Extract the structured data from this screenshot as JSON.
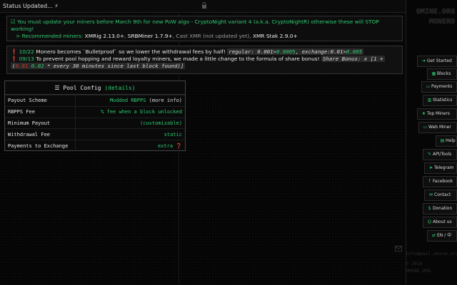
{
  "status": {
    "text": "Status Updated... ⚡"
  },
  "notice": {
    "icon": "check-square-icon",
    "line1": "You must update your miners before March 9th for new PoW algo - CryptoNight variant 4 (a.k.a. CryptoNightR) otherwise these will STOP working!",
    "rec_prefix": "> Recommended miners:",
    "miners": [
      "XMRig 2.13.0+",
      "SRBMiner 1.7.9+",
      "Cast XMR",
      "(not updated yet),",
      "XMR Stak 2.9.0+"
    ]
  },
  "news": [
    {
      "date": "10/22",
      "text": "Monero becomes `Bulletproof` so we lower the withdrawal fees by half!",
      "code_a": "regular: 0.001>",
      "code_a_g": "0.0005",
      "code_b": ", exchange:0.01>",
      "code_b_g": "0.005"
    },
    {
      "date": "09/13",
      "text": "To prevent pool hopping and reward loyalty miners, we made a little change to the formula of share bonus!",
      "code_a": "Share Bonus: x [1 +",
      "code_b_red": "0.01",
      "code_b_g": "0.02",
      "code_b_tail": "* every 30 minutes since last block found)]"
    }
  ],
  "pool": {
    "title": "Pool Config",
    "details": "(details)",
    "rows": [
      {
        "k": "Payout Scheme",
        "v": "Modded RBPPS",
        "v2": "(more info)"
      },
      {
        "k": "RBPPS Fee",
        "v": "% fee when a block unlocked",
        "v2": ""
      },
      {
        "k": "Minimum Payout",
        "v": "(customizable)",
        "v2": ""
      },
      {
        "k": "Withdrawal Fee",
        "v": "static",
        "v2": ""
      },
      {
        "k": "Payments to Exchange",
        "v": "extra ❓",
        "v2": ""
      }
    ]
  },
  "sidebar": {
    "logo1": "OMINE.ORG",
    "logo2": "MONERO",
    "items": [
      {
        "label": "Get Started",
        "icon": "arrow-right-icon"
      },
      {
        "label": "Blocks",
        "icon": "cubes-icon"
      },
      {
        "label": "Payments",
        "icon": "money-icon"
      },
      {
        "label": "Statistics",
        "icon": "chart-icon"
      },
      {
        "label": "Top Miners",
        "icon": "star-icon"
      },
      {
        "label": "Web Miner",
        "icon": "monitor-icon"
      },
      {
        "label": "Help",
        "icon": "book-icon"
      },
      {
        "label": "API/Tools",
        "icon": "wrench-icon"
      },
      {
        "label": "Telegram",
        "icon": "telegram-icon"
      },
      {
        "label": "Facebook",
        "icon": "facebook-icon"
      },
      {
        "label": "Contact",
        "icon": "chat-icon"
      },
      {
        "label": "Donation",
        "icon": "dollar-icon"
      },
      {
        "label": "About us",
        "icon": "users-icon"
      },
      {
        "label": "EN / 中",
        "icon": "language-icon"
      }
    ],
    "email": "info@mail.omine.org",
    "copy": "© 2018",
    "brand": "OMINE.ORG"
  }
}
